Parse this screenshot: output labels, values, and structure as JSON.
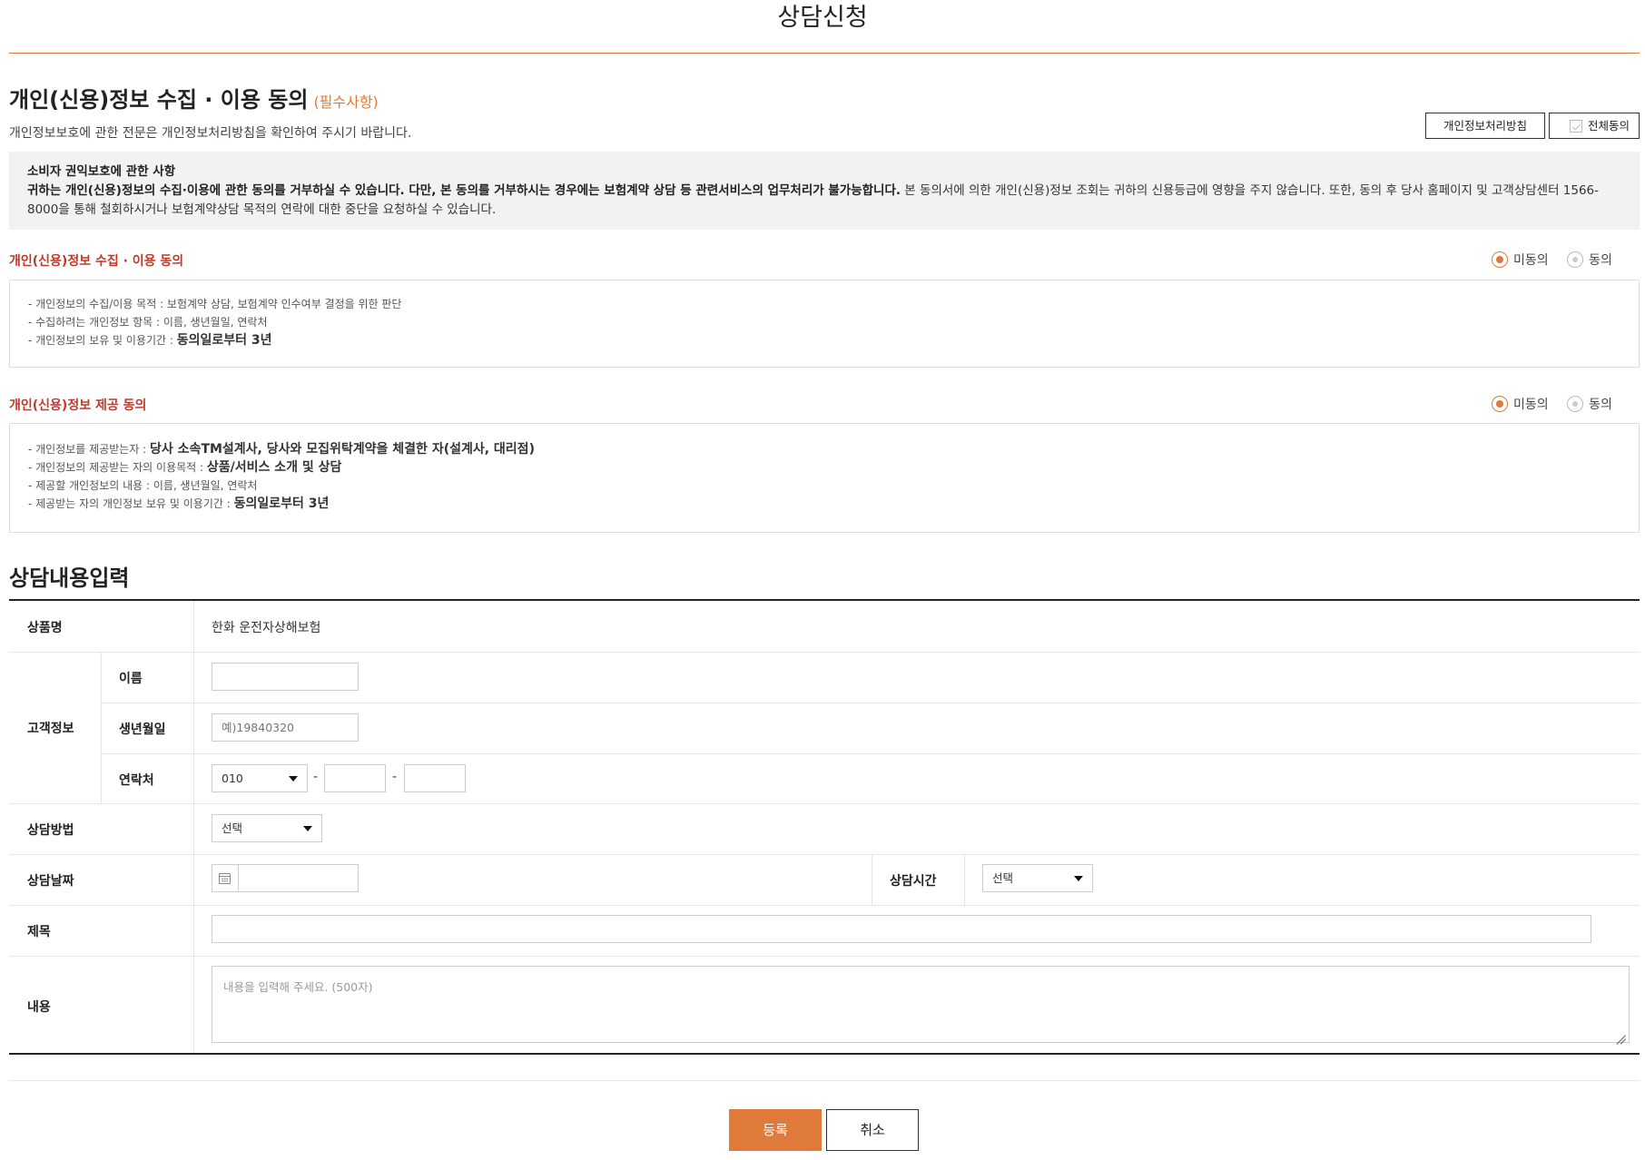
{
  "page": {
    "title": "상담신청"
  },
  "consent": {
    "heading": "개인(신용)정보 수집 · 이용 동의",
    "required_tag": "(필수사항)",
    "subtext": "개인정보보호에 관한 전문은 개인정보처리방침을 확인하여 주시기 바랍니다.",
    "policy_button": "개인정보처리방침",
    "agree_all_button": "전체동의",
    "notice": {
      "title": "소비자 권익보호에 관한 사항",
      "bold_text": "귀하는 개인(신용)정보의 수집·이용에 관한 동의를 거부하실 수 있습니다. 다만, 본 동의를 거부하시는 경우에는 보험계약 상담 등 관련서비스의 업무처리가 불가능합니다.",
      "normal_text": " 본 동의서에 의한 개인(신용)정보 조회는 귀하의 신용등급에 영향을 주지 않습니다. 또한, 동의 후 당사 홈페이지 및 고객상담센터 1566-8000을 통해 철회하시거나 보험계약상담 목적의 연락에 대한 중단을 요청하실 수 있습니다."
    },
    "collection": {
      "title": "개인(신용)정보 수집 · 이용 동의",
      "disagree_label": "미동의",
      "agree_label": "동의",
      "selected": "미동의",
      "items": [
        {
          "prefix": "- 개인정보의 수집/이용 목적 : 보험계약 상담, 보험계약 인수여부 결정을 위한 판단",
          "strong": ""
        },
        {
          "prefix": "- 수집하려는 개인정보 항목 : 이름, 생년월일, 연락처",
          "strong": ""
        },
        {
          "prefix": "- 개인정보의 보유 및 이용기간 : ",
          "strong": "동의일로부터 3년"
        }
      ]
    },
    "provision": {
      "title": "개인(신용)정보 제공 동의",
      "disagree_label": "미동의",
      "agree_label": "동의",
      "selected": "미동의",
      "items": [
        {
          "prefix": "- 개인정보를 제공받는자 : ",
          "strong": "당사 소속TM설계사, 당사와 모집위탁계약을 체결한 자(설계사, 대리점)"
        },
        {
          "prefix": "- 개인정보의 제공받는 자의 이용목적 : ",
          "strong": "상품/서비스 소개 및 상담"
        },
        {
          "prefix": "- 제공할 개인정보의 내용 : 이름, 생년월일, 연락처",
          "strong": ""
        },
        {
          "prefix": "- 제공받는 자의 개인정보 보유 및 이용기간 : ",
          "strong": "동의일로부터 3년"
        }
      ]
    }
  },
  "form": {
    "heading": "상담내용입력",
    "product_label": "상품명",
    "product_value": "한화 운전자상해보험",
    "customer_label": "고객정보",
    "name_label": "이름",
    "name_value": "",
    "birth_label": "생년월일",
    "birth_placeholder": "예)19840320",
    "phone_label": "연락처",
    "phone_prefix": "010",
    "phone_sep": "-",
    "method_label": "상담방법",
    "method_value": "선택",
    "date_label": "상담날짜",
    "date_value": "",
    "time_label": "상담시간",
    "time_value": "선택",
    "subject_label": "제목",
    "subject_value": "",
    "content_label": "내용",
    "content_placeholder": "내용을 입력해 주세요. (500자)"
  },
  "actions": {
    "submit": "등록",
    "cancel": "취소"
  },
  "colors": {
    "accent": "#e07a3a",
    "section_title": "#c0392b"
  }
}
